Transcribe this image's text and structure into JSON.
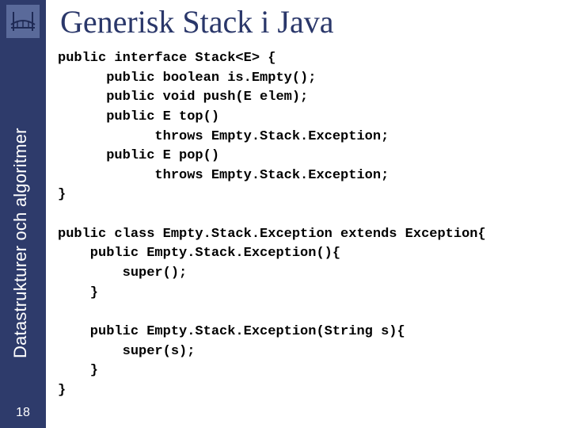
{
  "sidebar": {
    "vertical_label": "Datastrukturer och algoritmer",
    "page_number": "18"
  },
  "title": "Generisk Stack i Java",
  "code": {
    "l01": "public interface Stack<E> {",
    "l02": "      public boolean is.Empty();",
    "l03": "      public void push(E elem);",
    "l04": "      public E top()",
    "l05": "            throws Empty.Stack.Exception;",
    "l06": "      public E pop()",
    "l07": "            throws Empty.Stack.Exception;",
    "l08": "}",
    "l09": "",
    "l10": "public class Empty.Stack.Exception extends Exception{",
    "l11": "    public Empty.Stack.Exception(){",
    "l12": "        super();",
    "l13": "    }",
    "l14": "",
    "l15": "    public Empty.Stack.Exception(String s){",
    "l16": "        super(s);",
    "l17": "    }",
    "l18": "}"
  }
}
